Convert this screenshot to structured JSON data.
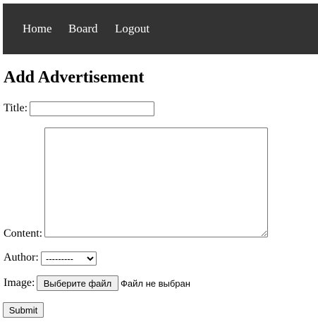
{
  "nav": {
    "items": [
      {
        "label": "Home"
      },
      {
        "label": "Board"
      },
      {
        "label": "Logout"
      }
    ],
    "background_color": "#333333",
    "text_color": "#ffffff"
  },
  "page": {
    "title": "Add Advertisement"
  },
  "form": {
    "title_label": "Title:",
    "title_value": "",
    "content_label": "Content:",
    "content_value": "",
    "author_label": "Author:",
    "author_selected": "---------",
    "image_label": "Image:",
    "file_button_label": "Выберите файл",
    "file_status": "Файл не выбран",
    "submit_label": "Submit"
  }
}
